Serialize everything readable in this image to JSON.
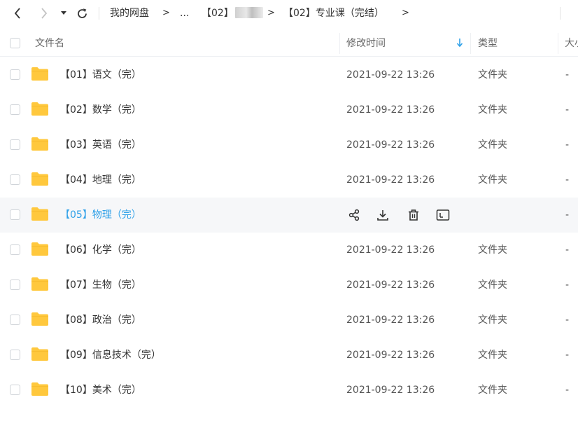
{
  "toolbar": {
    "refresh_label": "刷新"
  },
  "breadcrumb": {
    "items": [
      "我的网盘",
      "...",
      "【02】",
      "【02】专业课（完结）"
    ],
    "separator": ">"
  },
  "header": {
    "name": "文件名",
    "modified": "修改时间",
    "type": "类型",
    "size": "大小"
  },
  "rows": [
    {
      "name": "【01】语文（完）",
      "time": "2021-09-22 13:26",
      "type": "文件夹",
      "size": "-"
    },
    {
      "name": "【02】数学（完）",
      "time": "2021-09-22 13:26",
      "type": "文件夹",
      "size": "-"
    },
    {
      "name": "【03】英语（完）",
      "time": "2021-09-22 13:26",
      "type": "文件夹",
      "size": "-"
    },
    {
      "name": "【04】地理（完）",
      "time": "2021-09-22 13:26",
      "type": "文件夹",
      "size": "-"
    },
    {
      "name": "【05】物理（完）",
      "time": "",
      "type": "",
      "size": "-",
      "hovered": true
    },
    {
      "name": "【06】化学（完）",
      "time": "2021-09-22 13:26",
      "type": "文件夹",
      "size": "-"
    },
    {
      "name": "【07】生物（完）",
      "time": "2021-09-22 13:26",
      "type": "文件夹",
      "size": "-"
    },
    {
      "name": "【08】政治（完）",
      "time": "2021-09-22 13:26",
      "type": "文件夹",
      "size": "-"
    },
    {
      "name": "【09】信息技术（完）",
      "time": "2021-09-22 13:26",
      "type": "文件夹",
      "size": "-"
    },
    {
      "name": "【10】美术（完）",
      "time": "2021-09-22 13:26",
      "type": "文件夹",
      "size": "-"
    }
  ],
  "colors": {
    "accent": "#2ea0e8",
    "folder": "#ffc83d",
    "hover_bg": "#f6f7f9"
  },
  "icons": {
    "back": "chevron-left-icon",
    "forward": "chevron-right-icon",
    "history": "caret-down-icon",
    "refresh": "refresh-icon",
    "sort": "sort-down-arrow-icon",
    "folder": "folder-icon",
    "share": "share-icon",
    "download": "download-icon",
    "delete": "trash-icon",
    "rename": "rename-icon"
  }
}
